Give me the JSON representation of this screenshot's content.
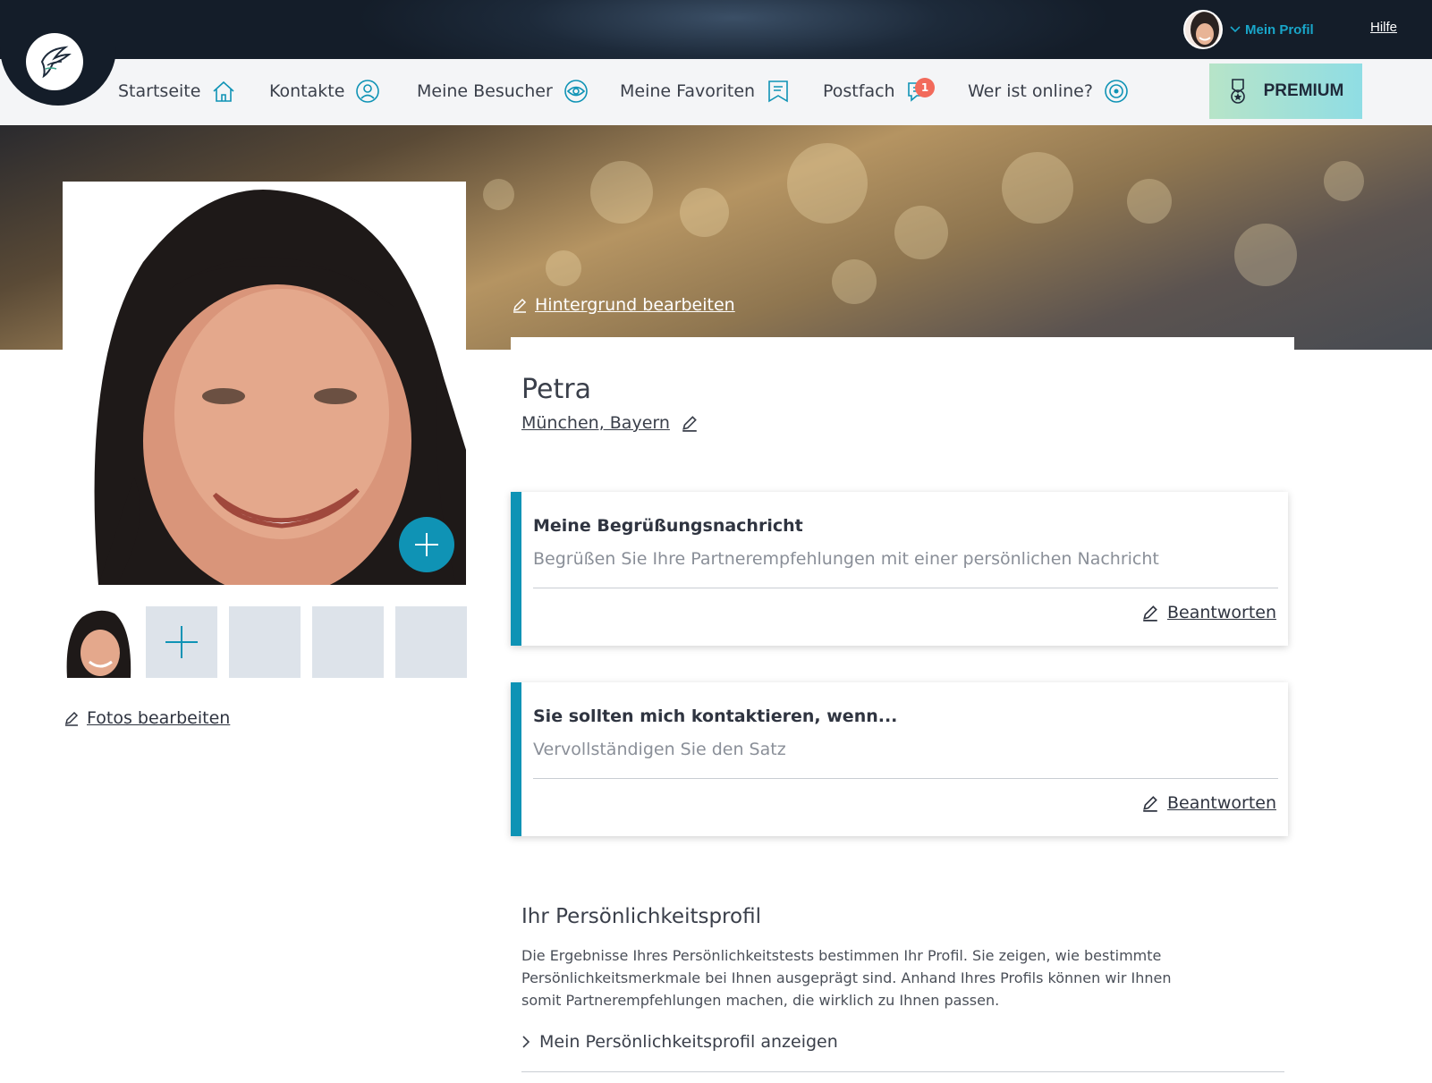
{
  "header": {
    "profile_label": "Mein Profil",
    "help_label": "Hilfe"
  },
  "nav": {
    "items": [
      {
        "label": "Startseite",
        "icon": "home-icon"
      },
      {
        "label": "Kontakte",
        "icon": "person-icon"
      },
      {
        "label": "Meine Besucher",
        "icon": "eye-icon"
      },
      {
        "label": "Meine Favoriten",
        "icon": "bookmark-icon"
      },
      {
        "label": "Postfach",
        "icon": "chat-icon"
      },
      {
        "label": "Wer ist online?",
        "icon": "radar-icon"
      }
    ],
    "mailbox_badge": "1",
    "premium_label": "PREMIUM"
  },
  "hero": {
    "edit_background_label": "Hintergrund bearbeiten"
  },
  "photos": {
    "edit_photos_label": "Fotos bearbeiten"
  },
  "profile": {
    "name": "Petra",
    "location": "München, Bayern"
  },
  "cards": [
    {
      "question": "Meine Begrüßungsnachricht",
      "hint": "Begrüßen Sie Ihre Partnerempfehlungen mit einer persönlichen Nachricht",
      "answer_label": "Beantworten"
    },
    {
      "question": "Sie sollten mich kontaktieren, wenn...",
      "hint": "Vervollständigen Sie den Satz",
      "answer_label": "Beantworten"
    }
  ],
  "personality": {
    "title": "Ihr Persönlichkeitsprofil",
    "text": "Die Ergebnisse Ihres Persönlichkeitstests bestimmen Ihr Profil. Sie zeigen, wie bestimmte Persönlichkeitsmerkmale bei Ihnen ausgeprägt sind. Anhand Ihres Profils können wir Ihnen somit Partnerempfehlungen machen, die wirklich zu Ihnen passen.",
    "show_label": "Mein Persönlichkeitsprofil anzeigen"
  },
  "colors": {
    "accent": "#0f93b5",
    "profile_link": "#19a6c9",
    "badge": "#f26a5b",
    "topbar": "#1d2a3a"
  }
}
